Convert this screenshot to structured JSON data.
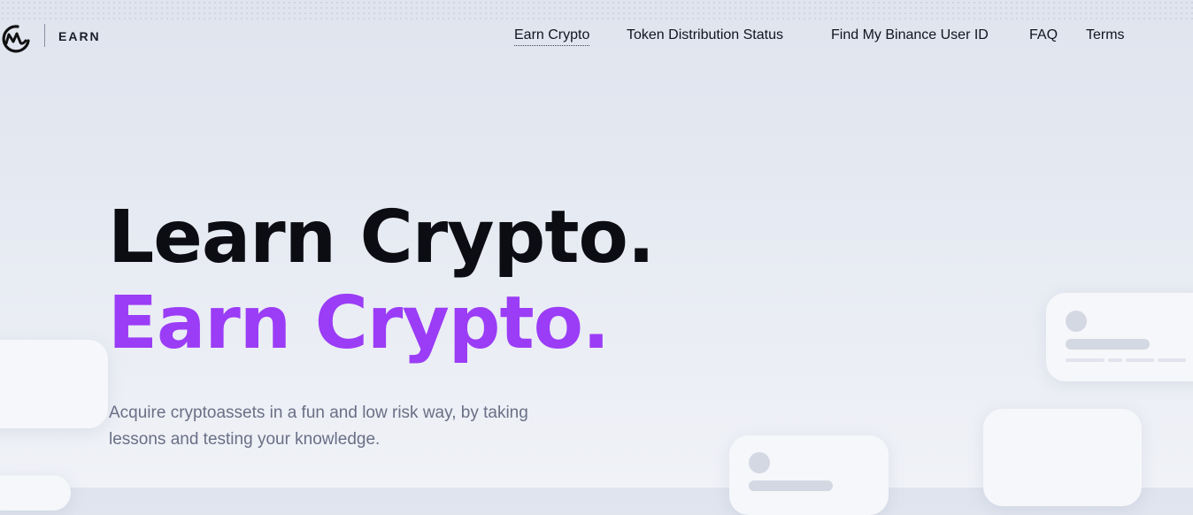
{
  "header": {
    "brand": "EARN",
    "logo_icon": "coinmarketcap-logo-icon",
    "nav": [
      {
        "label": "Earn Crypto",
        "active": true
      },
      {
        "label": "Token Distribution Status",
        "active": false
      },
      {
        "label": "Find My Binance User ID",
        "active": false
      },
      {
        "label": "FAQ",
        "active": false
      },
      {
        "label": "Terms",
        "active": false
      }
    ]
  },
  "hero": {
    "title_line1": "Learn Crypto.",
    "title_line2": "Earn Crypto.",
    "subtitle": "Acquire cryptoassets in a fun and low risk way, by taking lessons and testing your knowledge."
  },
  "colors": {
    "accent": "#9b3cf6",
    "text_dark": "#0c0d12",
    "text_muted": "#6a6f86",
    "background": "#e2e6ef"
  }
}
